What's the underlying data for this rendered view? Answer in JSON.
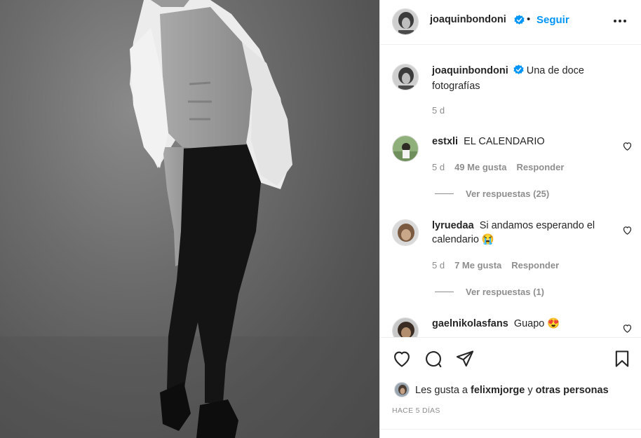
{
  "post": {
    "author": "joaquinbondoni",
    "separator": "•",
    "follow_label": "Seguir",
    "caption_user": "joaquinbondoni",
    "caption_text": "Una de doce fotografías",
    "caption_time": "5 d"
  },
  "comments": [
    {
      "user": "estxli",
      "text": "EL CALENDARIO",
      "time": "5 d",
      "likes": "49 Me gusta",
      "reply": "Responder",
      "view_replies": "Ver respuestas (25)"
    },
    {
      "user": "lyruedaa",
      "text": "Si andamos esperando el calendario 😭",
      "time": "5 d",
      "likes": "7 Me gusta",
      "reply": "Responder",
      "view_replies": "Ver respuestas (1)"
    },
    {
      "user": "gaelnikolasfans",
      "text": "Guapo 😍"
    }
  ],
  "likes_bar": {
    "prefix": "Les gusta a ",
    "user": "felixmjorge",
    "middle": " y ",
    "others": "otras personas"
  },
  "time_ago": "HACE 5 DÍAS",
  "colors": {
    "accent": "#0095f6",
    "verified": "#0095f6",
    "muted": "#8e8e8e",
    "text": "#262626"
  },
  "icons": [
    "verified-icon",
    "more-icon",
    "heart-icon",
    "comment-icon",
    "share-icon",
    "bookmark-icon"
  ]
}
